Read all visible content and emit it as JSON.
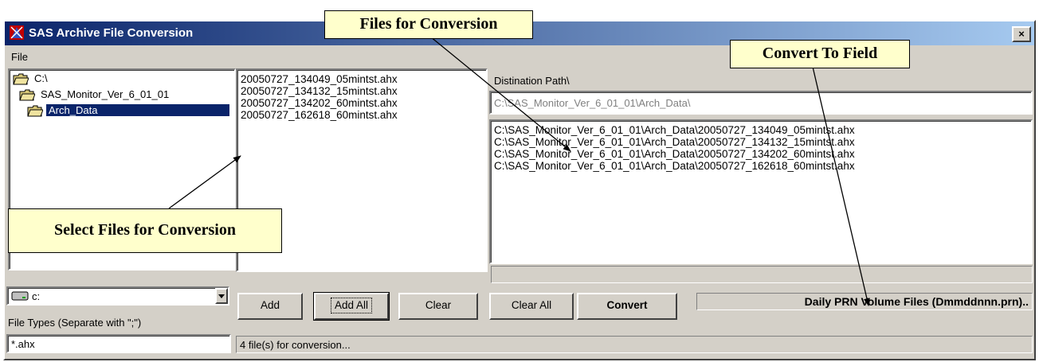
{
  "window": {
    "title": "SAS Archive File Conversion",
    "close_label": "×"
  },
  "menu": {
    "file": "File"
  },
  "folder_tree": {
    "items": [
      {
        "label": "C:\\",
        "selected": false
      },
      {
        "label": "SAS_Monitor_Ver_6_01_01",
        "selected": false
      },
      {
        "label": "Arch_Data",
        "selected": true
      }
    ]
  },
  "file_list": {
    "items": [
      "20050727_134049_05mintst.ahx",
      "20050727_134132_15mintst.ahx",
      "20050727_134202_60mintst.ahx",
      "20050727_162618_60mintst.ahx"
    ]
  },
  "destination": {
    "label": "Distination Path\\",
    "value": "C:\\SAS_Monitor_Ver_6_01_01\\Arch_Data\\"
  },
  "conversion_list": {
    "items": [
      "C:\\SAS_Monitor_Ver_6_01_01\\Arch_Data\\20050727_134049_05mintst.ahx",
      "C:\\SAS_Monitor_Ver_6_01_01\\Arch_Data\\20050727_134132_15mintst.ahx",
      "C:\\SAS_Monitor_Ver_6_01_01\\Arch_Data\\20050727_134202_60mintst.ahx",
      "C:\\SAS_Monitor_Ver_6_01_01\\Arch_Data\\20050727_162618_60mintst.ahx"
    ]
  },
  "drive_select": {
    "value": "c:"
  },
  "file_types": {
    "label": "File Types (Separate with \";\")",
    "value": "*.ahx"
  },
  "buttons": {
    "add": "Add",
    "add_all": "Add All",
    "clear": "Clear",
    "clear_all": "Clear All",
    "convert": "Convert"
  },
  "convert_to": {
    "value": "Daily PRN Volume Files (Dmmddnnn.prn).."
  },
  "status": {
    "text": "4 file(s) for conversion..."
  },
  "callouts": {
    "files_for_conversion": "Files for Conversion",
    "convert_to_field": "Convert To Field",
    "select_files": "Select Files for Conversion"
  },
  "colors": {
    "titlebar_start": "#0a246a",
    "titlebar_end": "#a6caf0",
    "dialog_face": "#d4d0c8",
    "selection": "#0a246a",
    "callout_fill": "#ffffcc"
  }
}
